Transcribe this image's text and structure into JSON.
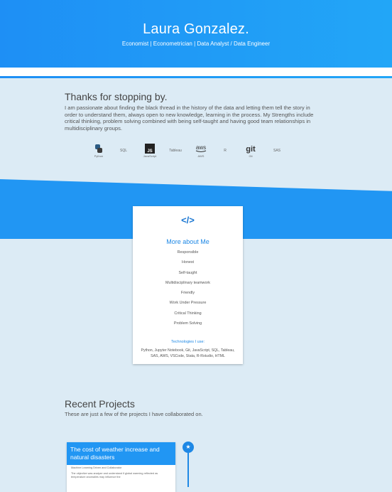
{
  "hero": {
    "name": "Laura Gonzalez.",
    "subtitle": "Economist | Econometrician | Data Analyst / Data Engineer"
  },
  "about": {
    "title": "Thanks for stopping by.",
    "text": "I am passionate about finding the black thread in the history of the data and letting them tell the story in order to understand them, always open to new knowledge, learning in the process. My Strengths include critical thinking, problem solving combined with being self-taught and having good team relationships in multidisciplinary groups."
  },
  "skills": [
    {
      "name": "python-icon",
      "label": "Python"
    },
    {
      "name": "sql-text",
      "label": "SQL"
    },
    {
      "name": "javascript-icon",
      "label": "JavaScript"
    },
    {
      "name": "tableau-text",
      "label": "Tableau"
    },
    {
      "name": "aws-icon",
      "label": "AWS"
    },
    {
      "name": "r-text",
      "label": "R"
    },
    {
      "name": "git-icon",
      "label": "Git"
    },
    {
      "name": "sas-text",
      "label": "SAS"
    }
  ],
  "card": {
    "title": "More about Me",
    "traits": [
      "Responsible",
      "Honest",
      "Self-taught",
      "Multidisciplinary teamwork",
      "Friendly",
      "Work Under Pressure",
      "Critical Thinking",
      "Problem Solving"
    ],
    "tech_title": "Technologies I use:",
    "tech_list": "Python, Jupyter Notebook, Git, JavaScript, SQL, Tableau, SAS, AWS, VSCode, Stata, R-Rstudio, HTML"
  },
  "projects": {
    "title": "Recent Projects",
    "subtitle": "These are just a few of the projects I have collaborated on.",
    "items": [
      {
        "title": "The cost of weather increase and natural disasters",
        "meta": "Machine Learning Driven and Collaborator",
        "desc": "The objective was analyze and understand if global warming reflected as temperature anomalies may influence the"
      }
    ]
  },
  "colors": {
    "primary": "#2196f3",
    "background": "#dcebf5"
  }
}
